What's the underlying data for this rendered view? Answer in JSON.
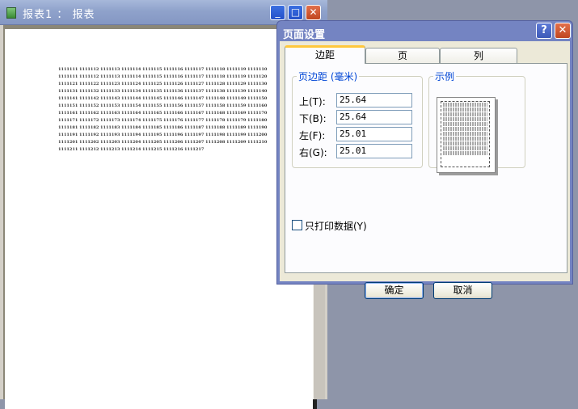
{
  "report_window": {
    "title": "报表1 ： 报表",
    "controls": {
      "minimize": "_",
      "maximize": "□",
      "close": "✕"
    },
    "cells": [
      "1111111",
      "1111112",
      "1111113",
      "1111114",
      "1111115",
      "1111116",
      "1111117",
      "1111118",
      "1111119",
      "1111110",
      "1111111",
      "1111112",
      "1111113",
      "1111114",
      "1111115",
      "1111116",
      "1111117",
      "1111118",
      "1111119",
      "1111120",
      "1111121",
      "1111122",
      "1111123",
      "1111124",
      "1111125",
      "1111126",
      "1111127",
      "1111128",
      "1111129",
      "1111130",
      "1111131",
      "1111132",
      "1111133",
      "1111134",
      "1111135",
      "1111136",
      "1111137",
      "1111138",
      "1111139",
      "1111140",
      "1111141",
      "1111142",
      "1111143",
      "1111144",
      "1111145",
      "1111146",
      "1111147",
      "1111148",
      "1111149",
      "1111150",
      "1111151",
      "1111152",
      "1111153",
      "1111154",
      "1111155",
      "1111156",
      "1111157",
      "1111158",
      "1111159",
      "1111160",
      "1111161",
      "1111162",
      "1111163",
      "1111164",
      "1111165",
      "1111166",
      "1111167",
      "1111168",
      "1111169",
      "1111170",
      "1111171",
      "1111172",
      "1111173",
      "1111174",
      "1111175",
      "1111176",
      "1111177",
      "1111178",
      "1111179",
      "1111180",
      "1111181",
      "1111182",
      "1111183",
      "1111184",
      "1111185",
      "1111186",
      "1111187",
      "1111188",
      "1111189",
      "1111190",
      "1111191",
      "1111192",
      "1111193",
      "1111194",
      "1111195",
      "1111196",
      "1111197",
      "1111198",
      "1111199",
      "1111200",
      "1111201",
      "1111202",
      "1111203",
      "1111204",
      "1111205",
      "1111206",
      "1111207",
      "1111208",
      "1111209",
      "1111210",
      "1111211",
      "1111212",
      "1111213",
      "1111214",
      "1111215",
      "1111216",
      "1111217"
    ]
  },
  "dialog": {
    "title": "页面设置",
    "help": "?",
    "close": "✕",
    "tabs": [
      "边距",
      "页",
      "列"
    ],
    "active_tab": "边距",
    "margins_group": "页边距 (毫米)",
    "margins": [
      {
        "label": "上(T):",
        "value": "25.64"
      },
      {
        "label": "下(B):",
        "value": "25.64"
      },
      {
        "label": "左(F):",
        "value": "25.01"
      },
      {
        "label": "右(G):",
        "value": "25.01"
      }
    ],
    "preview_group": "示例",
    "print_data_only": {
      "label": "只打印数据(Y)",
      "checked": false
    },
    "ok": "确定",
    "cancel": "取消"
  }
}
